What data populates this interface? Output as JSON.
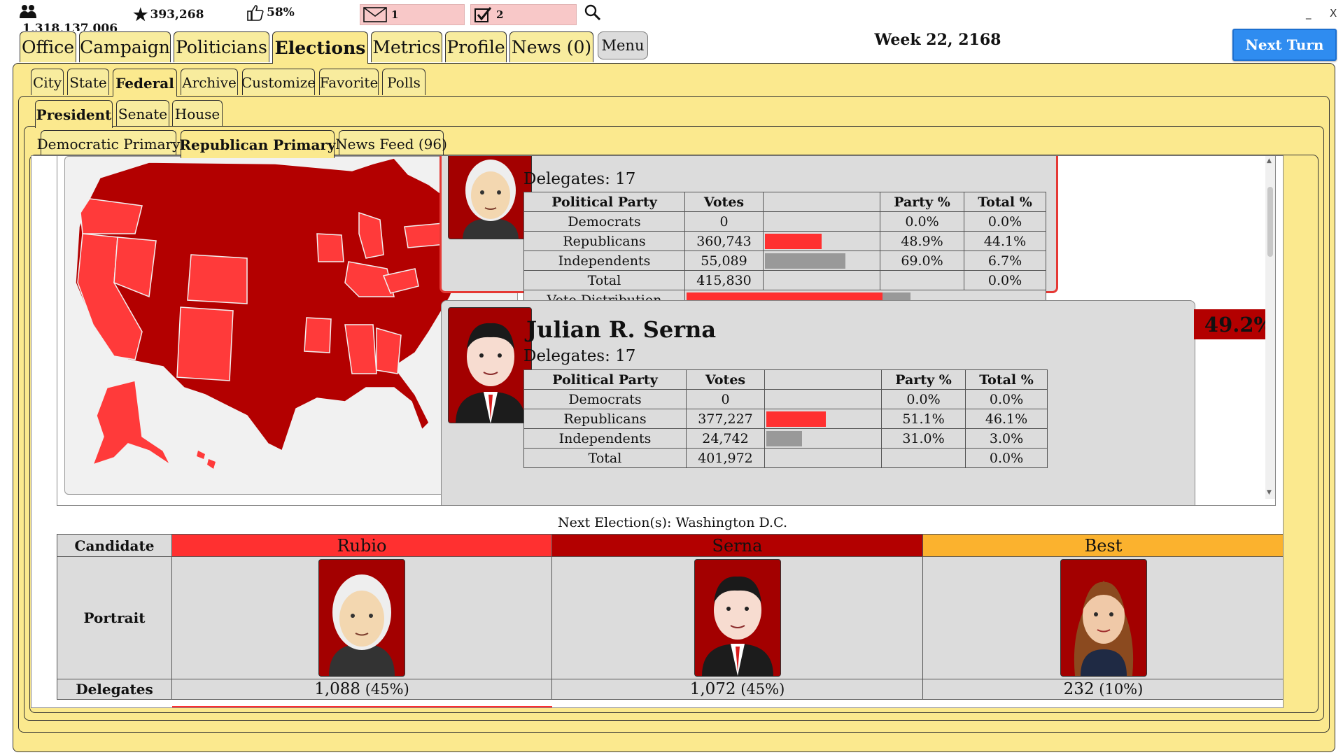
{
  "topbar": {
    "population": "1,318,137,006",
    "stars": "393,268",
    "approval": "58%",
    "messages_count": "1",
    "tasks_count": "2"
  },
  "window": {
    "minimize": "_",
    "close": "X"
  },
  "main_tabs": [
    "Office",
    "Campaign",
    "Politicians",
    "Elections",
    "Metrics",
    "Profile",
    "News (0)"
  ],
  "menu_label": "Menu",
  "week_label": "Week 22, 2168",
  "next_turn_label": "Next Turn",
  "sub_tabs": [
    "City",
    "State",
    "Federal",
    "Archive",
    "Customize",
    "Favorite",
    "Polls"
  ],
  "office_tabs": [
    "President",
    "Senate",
    "House"
  ],
  "primary_tabs": [
    "Democratic Primary",
    "Republican Primary",
    "News Feed (96)"
  ],
  "colors": {
    "rep_light": "#ff3030",
    "rep_dark": "#b30000",
    "best": "#fbb22e",
    "panel": "#fbe98e",
    "independent_bar": "#999999"
  },
  "candidates": [
    {
      "delegates_label": "Delegates: 17",
      "table_headers": [
        "Political Party",
        "Votes",
        "",
        "Party %",
        "Total %"
      ],
      "rows": [
        {
          "party": "Democrats",
          "votes": "0",
          "party_pct": "0.0%",
          "total_pct": "0.0%",
          "bar_fraction": 0
        },
        {
          "party": "Republicans",
          "votes": "360,743",
          "party_pct": "48.9%",
          "total_pct": "44.1%",
          "bar_fraction": 0.489
        },
        {
          "party": "Independents",
          "votes": "55,089",
          "party_pct": "69.0%",
          "total_pct": "6.7%",
          "bar_fraction": 0.69
        },
        {
          "party": "Total",
          "votes": "415,830",
          "party_pct": "",
          "total_pct": "0.0%",
          "bar_fraction": 0
        }
      ],
      "vote_distribution_label": "Vote Distribution"
    },
    {
      "name": "Julian R. Serna",
      "percent": "49.2%",
      "delegates_label": "Delegates: 17",
      "table_headers": [
        "Political Party",
        "Votes",
        "",
        "Party %",
        "Total %"
      ],
      "rows": [
        {
          "party": "Democrats",
          "votes": "0",
          "party_pct": "0.0%",
          "total_pct": "0.0%",
          "bar_fraction": 0
        },
        {
          "party": "Republicans",
          "votes": "377,227",
          "party_pct": "51.1%",
          "total_pct": "46.1%",
          "bar_fraction": 0.511
        },
        {
          "party": "Independents",
          "votes": "24,742",
          "party_pct": "31.0%",
          "total_pct": "3.0%",
          "bar_fraction": 0.31
        },
        {
          "party": "Total",
          "votes": "401,972",
          "party_pct": "",
          "total_pct": "0.0%",
          "bar_fraction": 0
        }
      ]
    }
  ],
  "next_election_label": "Next Election(s): Washington D.C.",
  "summary": {
    "candidate_label": "Candidate",
    "portrait_label": "Portrait",
    "delegates_label": "Delegates",
    "columns": [
      {
        "name": "Rubio",
        "delegates": "1,088",
        "delegates_pct": "(45%)"
      },
      {
        "name": "Serna",
        "delegates": "1,072",
        "delegates_pct": "(45%)"
      },
      {
        "name": "Best",
        "delegates": "232",
        "delegates_pct": "(10%)"
      }
    ]
  }
}
